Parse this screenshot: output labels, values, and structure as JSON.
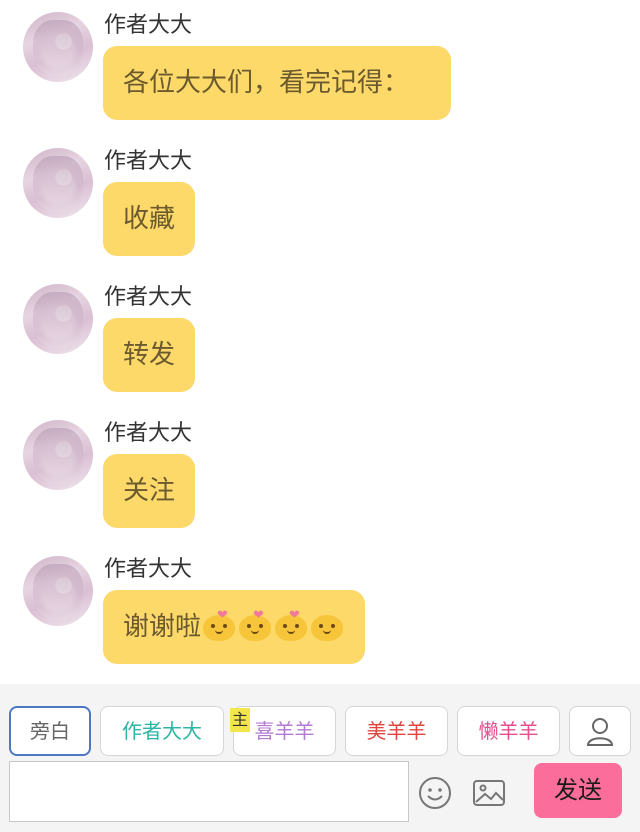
{
  "messages": [
    {
      "author": "作者大大",
      "text": "各位大大们，看完记得：",
      "emojis": []
    },
    {
      "author": "作者大大",
      "text": "收藏",
      "emojis": []
    },
    {
      "author": "作者大大",
      "text": "转发",
      "emojis": []
    },
    {
      "author": "作者大大",
      "text": "关注",
      "emojis": []
    },
    {
      "author": "作者大大",
      "text": "谢谢啦",
      "emojis": [
        "kiss-emoji",
        "love-emoji",
        "love-emoji",
        "wink-emoji"
      ]
    }
  ],
  "roles": [
    {
      "label": "旁白",
      "color": "#666666",
      "active": true
    },
    {
      "label": "作者大大",
      "color": "#2bb5a6",
      "active": false
    },
    {
      "label": "喜羊羊",
      "color": "#b27ad0",
      "active": false
    },
    {
      "label": "美羊羊",
      "color": "#e0463e",
      "active": false
    },
    {
      "label": "懒羊羊",
      "color": "#e34f8f",
      "active": false
    }
  ],
  "main_tag": "主",
  "composer": {
    "input_value": "",
    "send_label": "发送"
  },
  "icons": {
    "add_role": "user-icon",
    "emoji": "smiley-icon",
    "image": "image-icon"
  }
}
